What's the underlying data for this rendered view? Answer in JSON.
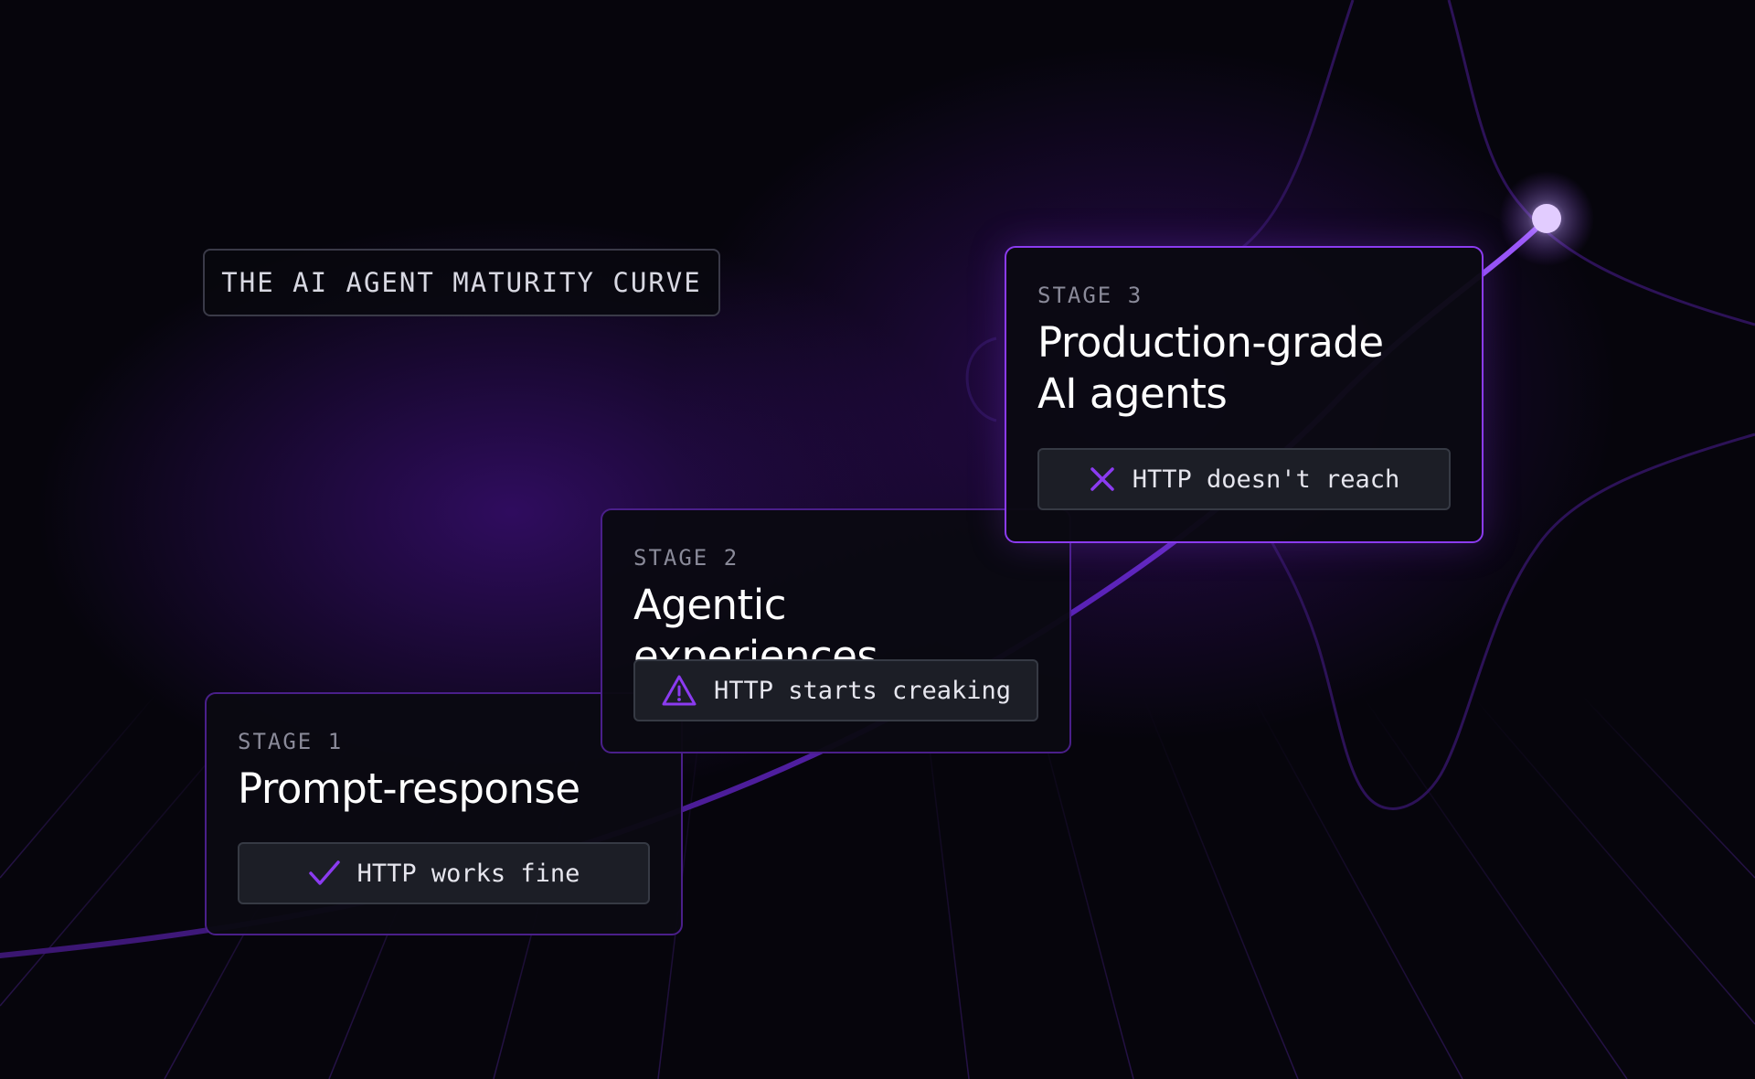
{
  "title": "THE AI AGENT MATURITY CURVE",
  "stages": [
    {
      "label": "STAGE 1",
      "heading": "Prompt-response",
      "status": "HTTP works fine",
      "status_icon": "check-icon"
    },
    {
      "label": "STAGE 2",
      "heading": "Agentic experiences",
      "status": "HTTP starts creaking",
      "status_icon": "warning-icon"
    },
    {
      "label": "STAGE 3",
      "heading_lines": [
        "Production-grade",
        "AI agents"
      ],
      "status": "HTTP doesn't reach",
      "status_icon": "x-icon"
    }
  ],
  "colors": {
    "accent": "#8b3bf0",
    "card_border": "#4a1f8a",
    "background": "#06050c"
  }
}
